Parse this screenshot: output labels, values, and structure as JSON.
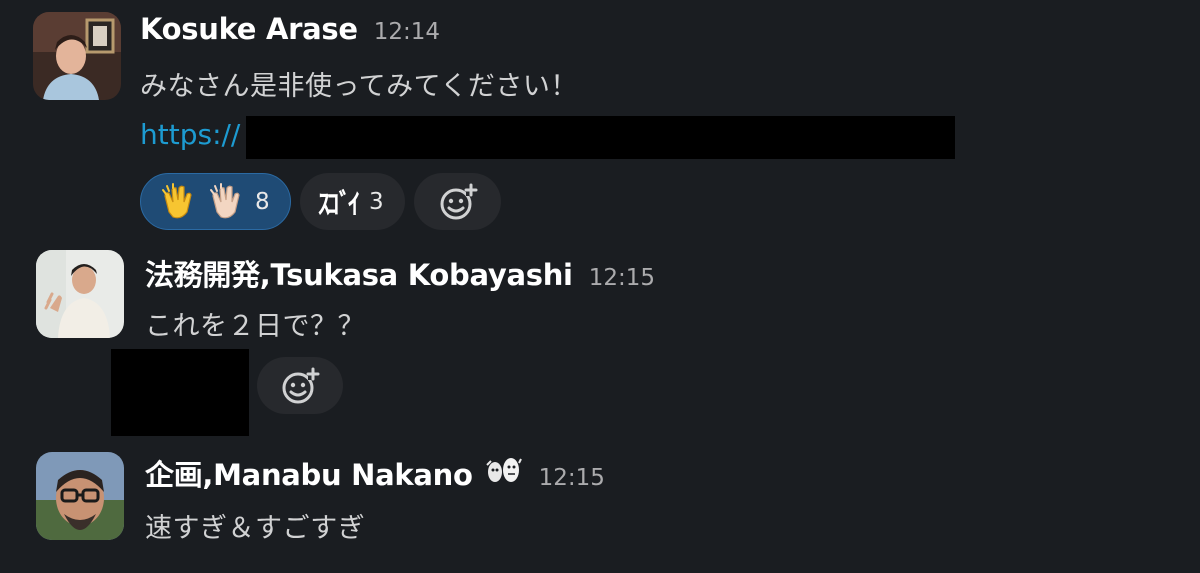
{
  "messages": [
    {
      "author": "Kosuke Arase",
      "time": "12:14",
      "text": "みなさん是非使ってみてください！",
      "link_prefix": "https://",
      "reactions": [
        {
          "emoji": "clap-light-and-dark",
          "count": "8",
          "active": true
        },
        {
          "emoji": "sugoi-custom",
          "label": "ｽｺﾞｲ",
          "count": "3",
          "active": false
        }
      ]
    },
    {
      "author": "法務開発,Tsukasa Kobayashi",
      "time": "12:15",
      "text": "これを２日で？？",
      "reactions": []
    },
    {
      "author": "企画,Manabu Nakano",
      "time": "12:15",
      "text": "速すぎ＆すごすぎ",
      "status_icon": "custom-status-icon"
    }
  ],
  "colors": {
    "background": "#1a1d21",
    "link": "#1d9bd1",
    "reaction_active": "#1f4b75",
    "reaction_default": "#27292d"
  }
}
